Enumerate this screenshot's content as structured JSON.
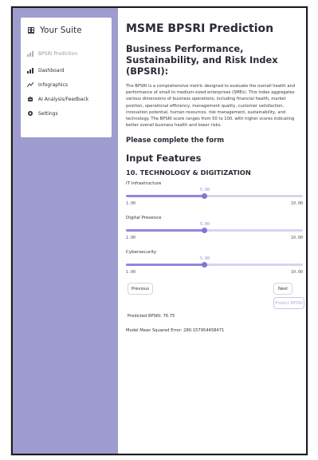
{
  "sidebar": {
    "title": "Your Suite",
    "items": [
      {
        "label": "BPSRI Prediction",
        "icon": "bar-chart-icon",
        "active": false
      },
      {
        "label": "Dashboard",
        "icon": "bar-chart-icon",
        "active": true
      },
      {
        "label": "Infographics",
        "icon": "line-chart-icon",
        "active": true
      },
      {
        "label": "AI Analysis/Feedback",
        "icon": "robot-icon",
        "active": true
      },
      {
        "label": "Settings",
        "icon": "gear-icon",
        "active": true
      }
    ]
  },
  "main": {
    "title": "MSME BPSRI Prediction",
    "subtitle": "Business Performance, Sustainability, and Risk Index (BPSRI):",
    "description": "The BPSRI is a comprehensive metric designed to evaluate the overall health and performance of small to medium-sized enterprises (SMEs). This index aggregates various dimensions of business operations, including financial health, market position, operational efficiency, management quality, customer satisfaction, innovation potential, human resources, risk management, sustainability, and technology. The BPSRI score ranges from 50 to 100, with higher scores indicating better overall business health and lower risks.",
    "form_prompt": "Please complete the form",
    "section_title": "Input Features",
    "category_title": "10. TECHNOLOGY & DIGITIZATION",
    "sliders": [
      {
        "label": "IT Infrastructure",
        "value": "5.00",
        "min": "1.00",
        "max": "10.00",
        "fraction": 0.444
      },
      {
        "label": "Digital Presence",
        "value": "5.00",
        "min": "1.00",
        "max": "10.00",
        "fraction": 0.444
      },
      {
        "label": "Cybersecurity",
        "value": "5.00",
        "min": "1.00",
        "max": "10.00",
        "fraction": 0.444
      }
    ],
    "buttons": {
      "previous": "Previous",
      "next": "Next",
      "predict": "Predict BPSRI"
    },
    "predicted": "Predicted BPSRI: 76.75",
    "mse": "Model Mean Squared Error: 280.157954458471"
  },
  "colors": {
    "sidebar_bg": "#9f9ccf",
    "accent": "#8f89d9"
  }
}
